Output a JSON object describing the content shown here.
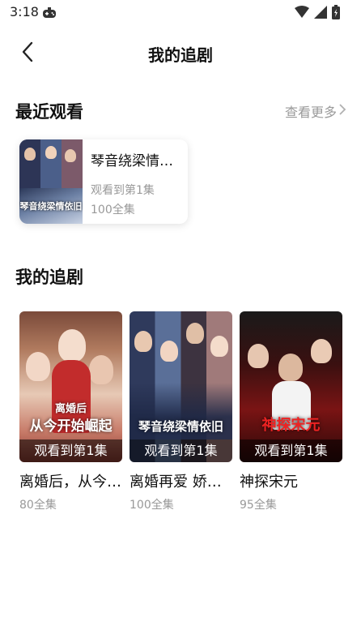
{
  "status": {
    "time": "3:18"
  },
  "nav": {
    "title": "我的追剧"
  },
  "recent": {
    "title": "最近观看",
    "see_more": "查看更多",
    "item": {
      "name": "琴音绕梁情依旧",
      "progress": "观看到第1集",
      "total": "100全集",
      "cover_text": "琴音绕梁情依旧"
    }
  },
  "favorites": {
    "title": "我的追剧",
    "items": [
      {
        "name": "离婚后，从今开始崛起",
        "badge": "观看到第1集",
        "total": "80全集",
        "cover_text": "从今开始崛起",
        "cover_sub": "离婚后"
      },
      {
        "name": "离婚再爱 娇妻难追",
        "badge": "观看到第1集",
        "total": "100全集",
        "cover_text": "琴音绕梁情依旧",
        "cover_sub": ""
      },
      {
        "name": "神探宋元",
        "badge": "观看到第1集",
        "total": "95全集",
        "cover_text": "神探宋元",
        "cover_sub": ""
      }
    ]
  },
  "colors": {
    "accent_text": "#111111",
    "muted_text": "#999999",
    "background": "#ffffff"
  },
  "icons": {
    "back": "chevron-left-icon",
    "more": "chevron-right-icon",
    "wifi": "wifi-icon",
    "signal": "signal-icon",
    "battery": "battery-icon",
    "game": "gamepad-icon"
  }
}
